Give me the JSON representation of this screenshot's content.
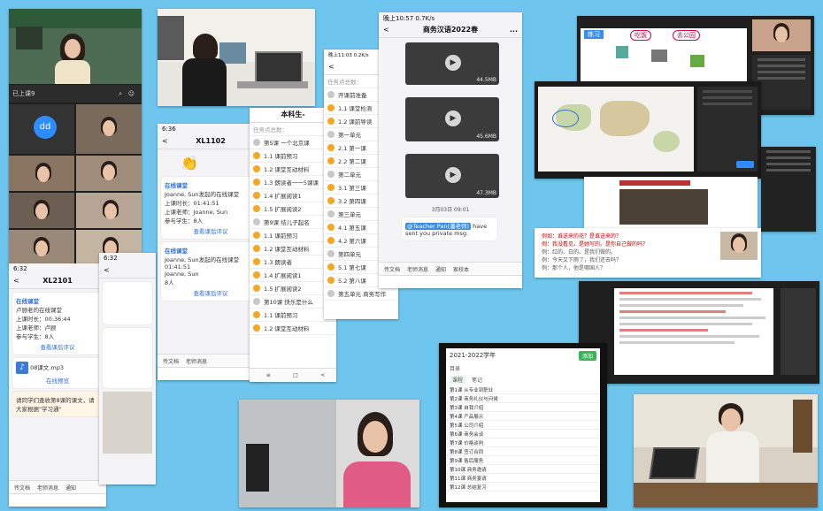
{
  "zoom_app": {
    "top_label": "已上课9",
    "avatar_text": "dd"
  },
  "chat_tall": {
    "time": "6:32",
    "back": "<",
    "title": "XL2101",
    "msg1_title": "在线课堂",
    "msg1_host": "卢顾老的在线课堂",
    "msg1_duration_label": "上课时长：",
    "msg1_duration": "00:36:44",
    "msg1_teacher_label": "上课老师：",
    "msg1_teacher": "卢顾",
    "msg1_count_label": "参与学生：",
    "msg1_count": "8人",
    "msg1_link": "查看课后评议",
    "audio_name": "08课文.mp3",
    "audio_link": "在线预览",
    "notice": "请同学们查收第8课的课文，请大家根据\"学习通\"",
    "tool1": "传文档",
    "tool2": "老师消息",
    "tool3": "通知",
    "tool4": "家校本"
  },
  "chat_mid": {
    "time": "6:36",
    "title": "XL1102",
    "card_title": "在线课堂",
    "card_host": "Joanne, Sun发起的在线课堂",
    "card_duration_label": "上课时长：",
    "card_duration": "01:41:51",
    "card_teacher_label": "上课老师：",
    "card_teacher": "Joanne, Sun",
    "card_count_label": "参与学生：",
    "card_count": "8人",
    "card_link": "查看课后评议",
    "card2_title": "在线课堂",
    "card2_host": "Joanne, Sun发起的在线课堂",
    "card2_duration": "01:41:51",
    "card2_teacher": "Joanne, Sun",
    "card2_count": "8人",
    "card2_link": "查看课后评议",
    "tool1": "传文档",
    "tool2": "老师消息"
  },
  "task_list": {
    "header": "本科生-",
    "section": "任务点总数：",
    "items": [
      "第5课 一个北京课",
      "1.1 课前预习",
      "1.2 课堂互动材料",
      "1.3 朗读者一一5课课",
      "1.4 扩展阅读1",
      "1.5 扩展阅读2",
      "第9课 结儿子起名",
      "1.1 课前预习",
      "1.2 课堂互动材料",
      "1.3 朗读者",
      "1.4 扩展阅读1",
      "1.5 扩展阅读2",
      "第10课 快乐是什么",
      "1.1 课前预习",
      "1.2 课堂互动材料"
    ]
  },
  "task_list2": {
    "time": "晚上11:03 0.2K/s",
    "back": "<",
    "section": "任务点总数：",
    "items": [
      "开课前准备",
      "1.1 课堂检测",
      "1.2 课前导读",
      "第一单元",
      "2.1 第一课",
      "2.2 第二课",
      "第二单元",
      "3.1 第三课",
      "3.2 第四课",
      "第三单元",
      "4.1 第五课",
      "4.2 第六课",
      "第四单元",
      "5.1 第七课",
      "5.2 第八课",
      "第五单元 商务写作"
    ]
  },
  "video_chat": {
    "time": "晚上10:57 0.7K/s",
    "title": "商务汉语2022春",
    "back": "<",
    "more": "...",
    "file_size1": "44.5MB",
    "file_size2": "45.6MB",
    "file_size3": "47.3MB",
    "date": "3月03日 09:01",
    "mention": "@Teacher Pan(潘老师)",
    "msg": "have sent you private msg.",
    "tool1": "传文档",
    "tool2": "老师消息",
    "tool3": "通知",
    "tool4": "家校本"
  },
  "course_outline": {
    "title": "2021-2022学年",
    "header_label": "目录",
    "tab1": "课程",
    "tab2": "笔记",
    "button": "添加",
    "items": [
      "第1课 从专业到职业",
      "第2课 商务礼仪与问候",
      "第3课 自我介绍",
      "第4课 产品展示",
      "第5课 公司介绍",
      "第6课 商务会谈",
      "第7课 价格谈判",
      "第8课 签订合同",
      "第9课 售后服务",
      "第10课 商务邀请",
      "第11课 商务宴请",
      "第12课 总结复习"
    ]
  },
  "lesson_slide": {
    "label": "练习",
    "chip1": "吃饭",
    "chip2": "去公园"
  },
  "board": {
    "line1": "例如：谁送来的花？是谁送来的？",
    "line2": "例：我没看见，是她写的。是你自己做的吗？",
    "line3": "例：红的、白的、是我们做的。",
    "line4": "例：今天又下雨了，我们还去吗？",
    "line5": "例：那个人，他是哪国人？"
  }
}
